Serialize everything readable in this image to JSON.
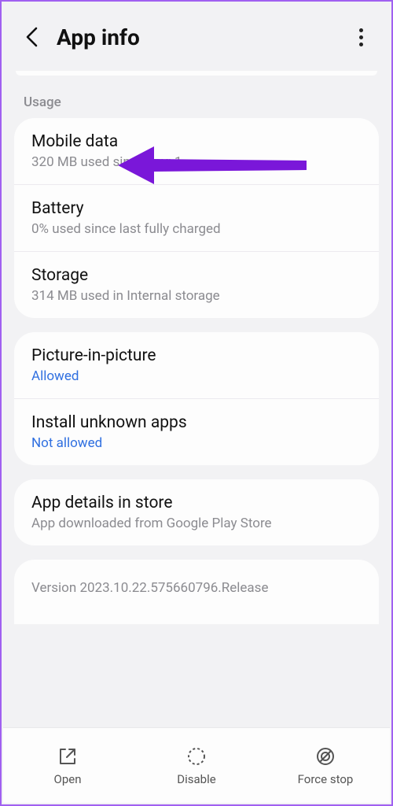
{
  "header": {
    "title": "App info"
  },
  "sections": {
    "usage_label": "Usage",
    "mobile_data": {
      "title": "Mobile data",
      "sub": "320 MB used since Aug 1"
    },
    "battery": {
      "title": "Battery",
      "sub": "0% used since last fully charged"
    },
    "storage": {
      "title": "Storage",
      "sub": "314 MB used in Internal storage"
    },
    "pip": {
      "title": "Picture-in-picture",
      "sub": "Allowed"
    },
    "unknown": {
      "title": "Install unknown apps",
      "sub": "Not allowed"
    },
    "store": {
      "title": "App details in store",
      "sub": "App downloaded from Google Play Store"
    },
    "version": "Version 2023.10.22.575660796.Release"
  },
  "bottom": {
    "open": "Open",
    "disable": "Disable",
    "force_stop": "Force stop"
  },
  "annotation": {
    "arrow_color": "#7a17d9"
  }
}
